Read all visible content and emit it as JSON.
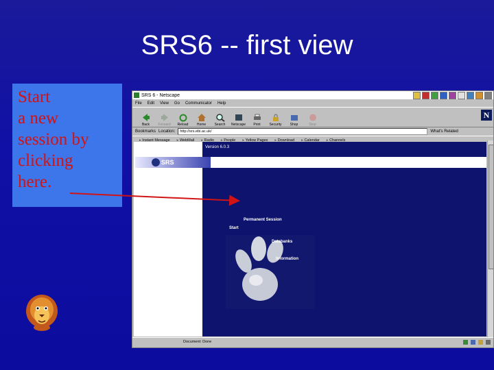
{
  "slide": {
    "title": "SRS6 -- first view",
    "callout_text": "Start\na new\nsession by\nclicking\nhere."
  },
  "browser": {
    "window_title": "SRS 6 - Netscape",
    "menu": [
      "File",
      "Edit",
      "View",
      "Go",
      "Communicator",
      "Help"
    ],
    "toolbar": [
      "Back",
      "Forward",
      "Reload",
      "Home",
      "Search",
      "Netscape",
      "Print",
      "Security",
      "Shop",
      "Stop"
    ],
    "location_label": "Location:",
    "bookmarks_label": "Bookmarks",
    "url": "http://srs.ebi.ac.uk/",
    "whats_related": "What's Related",
    "personal_toolbar": [
      "Instant Message",
      "WebMail",
      "Radio",
      "People",
      "Yellow Pages",
      "Download",
      "Calendar",
      "Channels"
    ],
    "status": "Document: Done",
    "logo_letter": "N"
  },
  "page": {
    "version": "Version 6.0.3",
    "logo": "SRS",
    "permanent_session": "Permanent Session",
    "start": "Start",
    "databanks": "Databanks",
    "information": "Information"
  },
  "colors": {
    "slide_bg": "#1010a6",
    "callout_bg": "#3d75ea",
    "callout_text": "#d11313",
    "page_bg": "#0e136e",
    "arrow": "#d11313"
  }
}
